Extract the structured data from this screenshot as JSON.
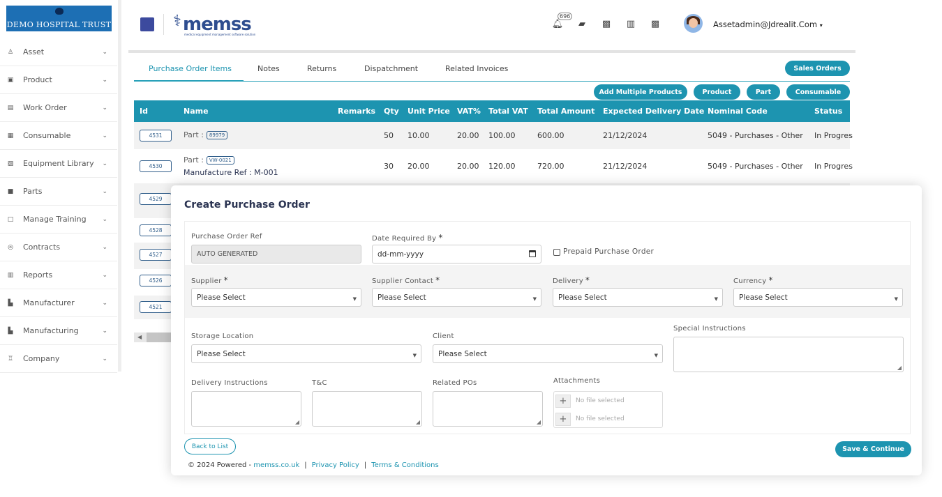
{
  "sidebar": {
    "logo": "DEMO HOSPITAL TRUST",
    "items": [
      {
        "label": "Asset",
        "icon": "asset-icon"
      },
      {
        "label": "Product",
        "icon": "product-icon"
      },
      {
        "label": "Work Order",
        "icon": "work-order-icon"
      },
      {
        "label": "Consumable",
        "icon": "grid-icon"
      },
      {
        "label": "Equipment Library",
        "icon": "library-icon"
      },
      {
        "label": "Parts",
        "icon": "briefcase-icon"
      },
      {
        "label": "Manage Training",
        "icon": "laptop-icon"
      },
      {
        "label": "Contracts",
        "icon": "handshake-icon"
      },
      {
        "label": "Reports",
        "icon": "report-icon"
      },
      {
        "label": "Manufacturer",
        "icon": "factory-icon"
      },
      {
        "label": "Manufacturing",
        "icon": "factory-icon"
      },
      {
        "label": "Company",
        "icon": "company-icon"
      }
    ]
  },
  "header": {
    "brand": "memss",
    "brand_tagline": "medical equipment management software solution",
    "notification_count": "696",
    "user": "Assetadmin@Jdrealit.Com"
  },
  "tabs": [
    "Purchase Order Items",
    "Notes",
    "Returns",
    "Dispatchment",
    "Related Invoices"
  ],
  "buttons": {
    "sales_orders": "Sales Orders",
    "add_multiple": "Add Multiple Products",
    "product": "Product",
    "part": "Part",
    "consumable": "Consumable"
  },
  "table": {
    "columns": [
      "Id",
      "Name",
      "Remarks",
      "Qty",
      "Unit Price",
      "VAT%",
      "Total VAT",
      "Total Amount",
      "Expected Delivery Date",
      "Nominal Code",
      "Status"
    ],
    "rows": [
      {
        "id": "4531",
        "name_prefix": "Part :",
        "part_tag": "89979",
        "manufacture_ref": "",
        "qty": "50",
        "unit_price": "10.00",
        "vat": "20.00",
        "total_vat": "100.00",
        "total_amount": "600.00",
        "date": "21/12/2024",
        "nominal": "5049 - Purchases - Other",
        "status": "In Progres"
      },
      {
        "id": "4530",
        "name_prefix": "Part :",
        "part_tag": "VW-0021",
        "manufacture_ref": "Manufacture Ref :  M-001",
        "qty": "30",
        "unit_price": "20.00",
        "vat": "20.00",
        "total_vat": "120.00",
        "total_amount": "720.00",
        "date": "21/12/2024",
        "nominal": "5049 - Purchases - Other",
        "status": "In Progres"
      }
    ],
    "more_ids": [
      "4529",
      "4528",
      "4527",
      "4526",
      "4521"
    ]
  },
  "modal": {
    "title": "Create Purchase Order",
    "po_ref_label": "Purchase Order Ref",
    "po_ref_value": "AUTO GENERATED",
    "date_label": "Date Required By",
    "date_placeholder": "dd-mm-yyyy",
    "prepaid_label": "Prepaid Purchase Order",
    "supplier_label": "Supplier",
    "supplier_contact_label": "Supplier Contact",
    "delivery_label": "Delivery",
    "currency_label": "Currency",
    "storage_label": "Storage Location",
    "client_label": "Client",
    "special_label": "Special Instructions",
    "delivery_instr_label": "Delivery Instructions",
    "tc_label": "T&C",
    "related_label": "Related POs",
    "attachments_label": "Attachments",
    "select_placeholder": "Please Select",
    "no_file": "No file selected",
    "required_mark": "*",
    "back_button": "Back to List",
    "save_button": "Save & Continue"
  },
  "footer": {
    "copyright": "© 2024 Powered - ",
    "site": "memss.co.uk",
    "privacy": "Privacy Policy",
    "terms": "Terms & Conditions"
  },
  "colors": {
    "accent": "#1d94b0",
    "logo_bg": "#1d6fb4",
    "brand": "#2e4d8f"
  }
}
